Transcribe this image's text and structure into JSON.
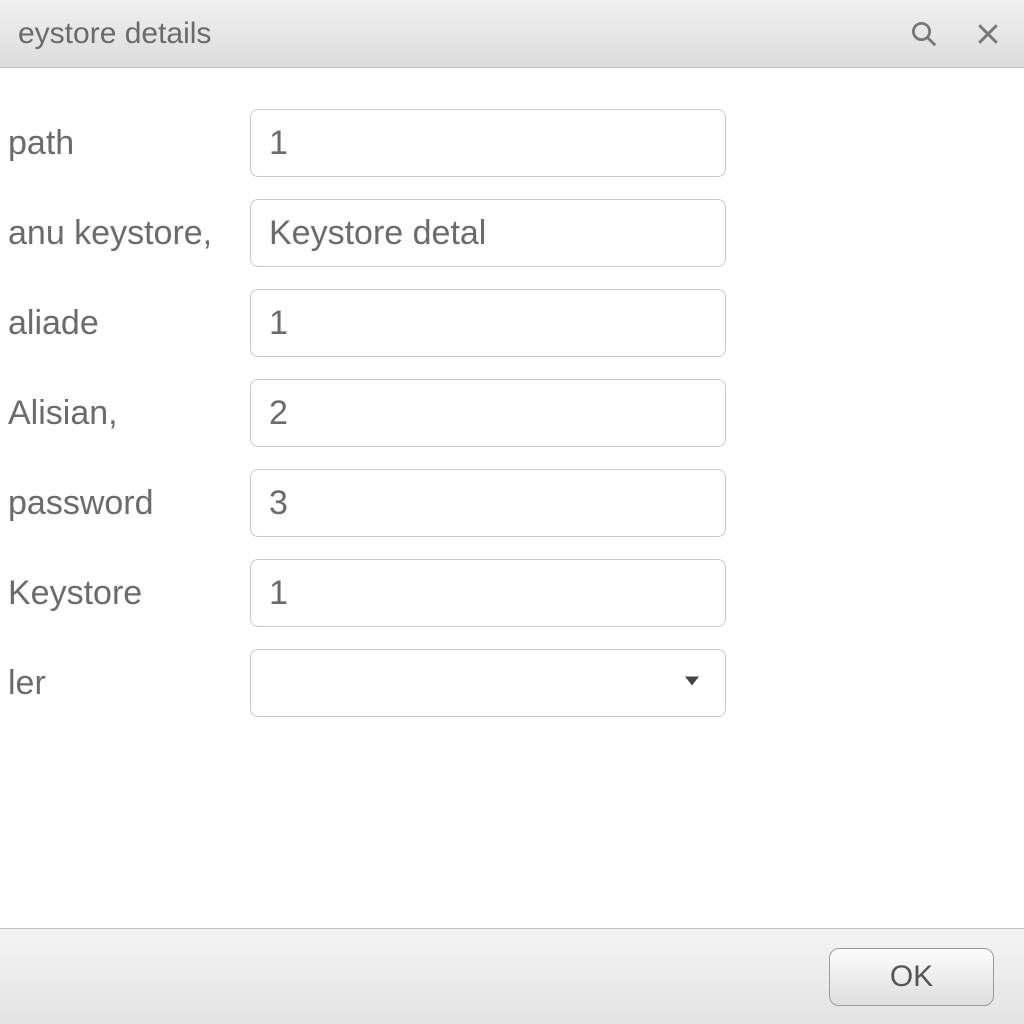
{
  "titlebar": {
    "title": "eystore details",
    "search_icon": "search-icon",
    "close_icon": "close-icon"
  },
  "form": {
    "rows": [
      {
        "label": "path",
        "value": "1"
      },
      {
        "label": "anu keystore,",
        "value": "Keystore detal"
      },
      {
        "label": "aliade",
        "value": "1"
      },
      {
        "label": "Alisian,",
        "value": "2"
      },
      {
        "label": "password",
        "value": "3"
      },
      {
        "label": "Keystore",
        "value": "1"
      }
    ],
    "dropdown": {
      "label": "ler",
      "value": ""
    }
  },
  "footer": {
    "ok_label": "OK"
  }
}
